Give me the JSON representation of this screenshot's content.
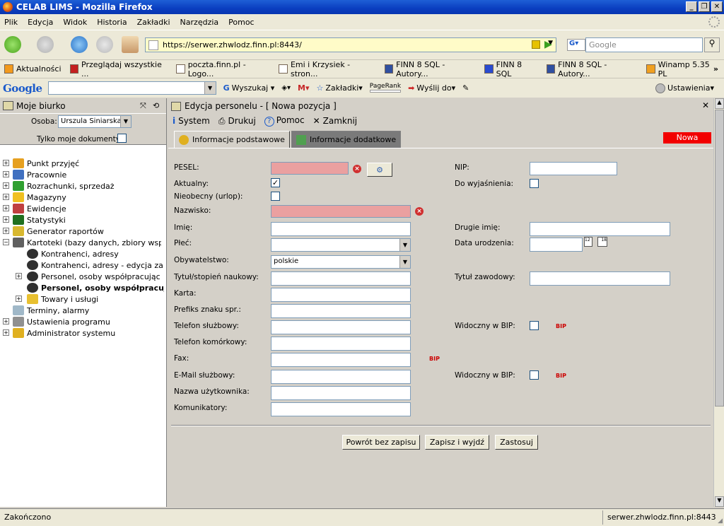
{
  "window": {
    "title": "CELAB LIMS - Mozilla Firefox"
  },
  "menubar": [
    "Plik",
    "Edycja",
    "Widok",
    "Historia",
    "Zakładki",
    "Narzędzia",
    "Pomoc"
  ],
  "nav": {
    "url": "https://serwer.zhwlodz.finn.pl:8443/",
    "search_placeholder": "Google"
  },
  "bookmarks": [
    "Aktualności",
    "Przeglądaj wszystkie ...",
    "poczta.finn.pl - Logo...",
    "Emi i Krzysiek - stron...",
    "FINN 8 SQL - Autory...",
    "FINN 8 SQL",
    "FINN 8 SQL - Autory...",
    "Winamp 5.35 PL"
  ],
  "google_toolbar": {
    "logo": "Google",
    "search_label": "Wyszukaj",
    "bookmarks_label": "Zakładki",
    "pagerank": "PageRank",
    "send_label": "Wyślij do",
    "settings_label": "Ustawienia"
  },
  "left": {
    "title": "Moje biurko",
    "person_label": "Osoba:",
    "person_value": "Urszula Siniarska",
    "only_mine_label": "Tylko moje dokumenty:",
    "tree": [
      "Punkt przyjęć",
      "Pracownie",
      "Rozrachunki, sprzedaż",
      "Magazyny",
      "Ewidencje",
      "Statystyki",
      "Generator raportów",
      "Kartoteki (bazy danych, zbiory wspo",
      "Kontrahenci, adresy",
      "Kontrahenci, adresy - edycja za",
      "Personel, osoby współpracując",
      "Personel, osoby współpracuja",
      "Towary i usługi",
      "Terminy, alarmy",
      "Ustawienia programu",
      "Administrator systemu"
    ]
  },
  "main": {
    "title": "Edycja personelu - [ Nowa pozycja ]",
    "toolbar": {
      "system": "System",
      "print": "Drukuj",
      "help": "Pomoc",
      "close": "Zamknij"
    },
    "tabs": {
      "basic": "Informacje podstawowe",
      "extra": "Informacje dodatkowe"
    },
    "status_badge": "Nowa",
    "fields": {
      "pesel": "PESEL:",
      "aktualny": "Aktualny:",
      "nieobecny": "Nieobecny (urlop):",
      "nazwisko": "Nazwisko:",
      "imie": "Imię:",
      "plec": "Płeć:",
      "obywatelstwo": "Obywatelstwo:",
      "obywatelstwo_value": "polskie",
      "tytul": "Tytuł/stopień naukowy:",
      "karta": "Karta:",
      "prefiks": "Prefiks znaku spr.:",
      "tel_sluzb": "Telefon służbowy:",
      "tel_kom": "Telefon komórkowy:",
      "fax": "Fax:",
      "email": "E-Mail służbowy:",
      "login": "Nazwa użytkownika:",
      "komunikatory": "Komunikatory:",
      "nip": "NIP:",
      "do_wyjasnienia": "Do wyjaśnienia:",
      "drugie_imie": "Drugie imię:",
      "data_urodzenia": "Data urodzenia:",
      "tytul_zawodowy": "Tytuł zawodowy:",
      "widoczny_bip_1": "Widoczny w BIP:",
      "widoczny_bip_2": "Widoczny w BIP:",
      "bip_tag": "BIP"
    },
    "buttons": {
      "back": "Powrót bez zapisu",
      "save_exit": "Zapisz i wyjdź",
      "apply": "Zastosuj"
    }
  },
  "status": {
    "left": "Zakończono",
    "right": "serwer.zhwlodz.finn.pl:8443"
  }
}
